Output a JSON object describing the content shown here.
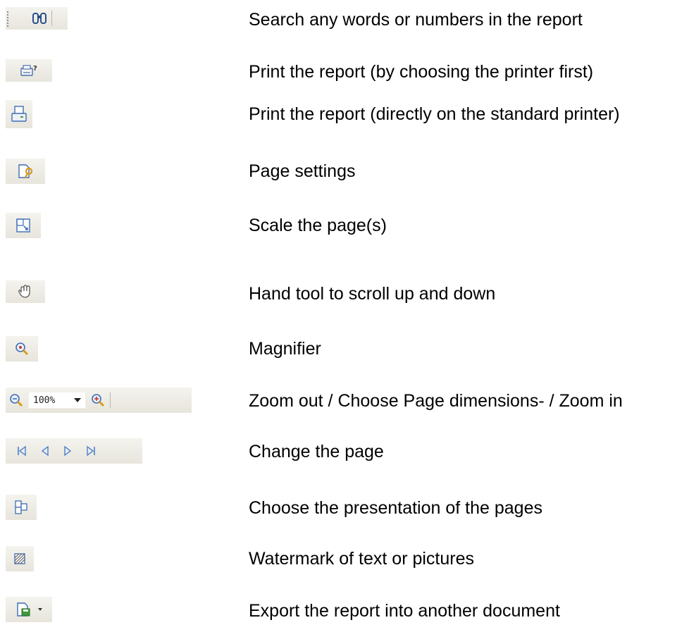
{
  "rows": [
    {
      "icon": "binoculars-icon",
      "description": "Search any words or numbers in the report"
    },
    {
      "icon": "print-dialog-icon",
      "description": "Print the report (by choosing the printer first)"
    },
    {
      "icon": "printer-icon",
      "description": "Print the report (directly on the standard printer)"
    },
    {
      "icon": "page-settings-icon",
      "description": "Page settings"
    },
    {
      "icon": "scale-page-icon",
      "description": "Scale the page(s)"
    },
    {
      "icon": "hand-tool-icon",
      "description": "Hand tool to scroll up and down"
    },
    {
      "icon": "magnifier-icon",
      "description": "Magnifier"
    },
    {
      "icon": "zoom-controls",
      "description": "Zoom out / Choose Page dimensions- / Zoom in"
    },
    {
      "icon": "page-navigation",
      "description": "Change the page"
    },
    {
      "icon": "page-layout-icon",
      "description": "Choose the presentation of the pages"
    },
    {
      "icon": "watermark-icon",
      "description": "Watermark of text or pictures"
    },
    {
      "icon": "export-icon",
      "description": "Export the report into another document"
    }
  ],
  "zoom": {
    "value": "100%"
  },
  "colors": {
    "toolbar": "#ece9d8",
    "icon_blue": "#3f6db3",
    "icon_gold": "#d89a1c",
    "text": "#000000"
  }
}
